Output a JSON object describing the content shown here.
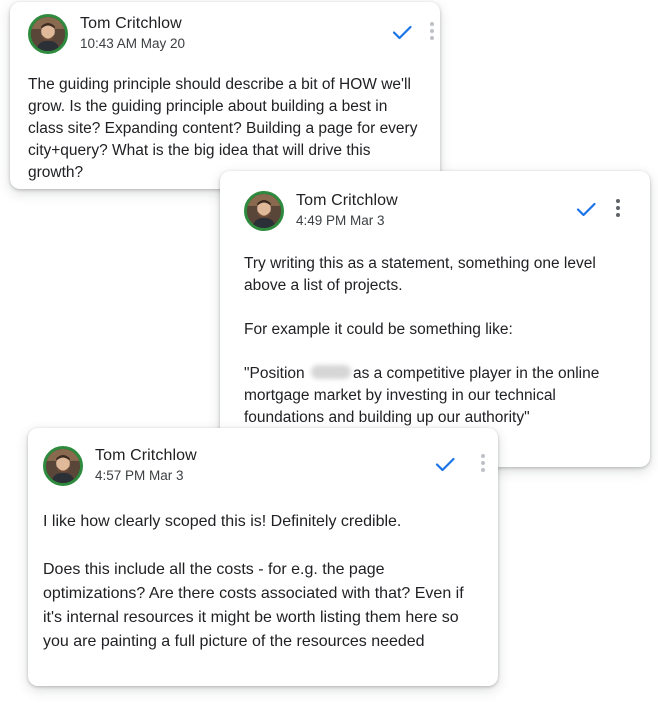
{
  "comments": [
    {
      "author": "Tom Critchlow",
      "timestamp": "10:43 AM May 20",
      "body": "The guiding principle should describe a bit of HOW we'll grow. Is the guiding principle about building a best in class site? Expanding content? Building a page for every city+query? What is the big idea that will drive this growth?"
    },
    {
      "author": "Tom Critchlow",
      "timestamp": "4:49 PM Mar 3",
      "body_p1": "Try writing this as a statement, something one level above a list of projects.",
      "body_p2": "For example it could be something like:",
      "body_p3_before": "\"Position ",
      "body_p3_after": "as a competitive player in the online mortgage market by investing in our technical foundations and building up our authority\""
    },
    {
      "author": "Tom Critchlow",
      "timestamp": "4:57 PM Mar 3",
      "body_p1": "I like how clearly scoped this is! Definitely credible.",
      "body_p2": "Does this include all the costs - for e.g. the page optimizations? Are there costs associated with that? Even if it's internal resources it might be worth listing them here so you are painting a full picture of the resources needed"
    }
  ],
  "icons": {
    "resolve": "checkmark-icon",
    "more": "more-vert-icon",
    "avatar": "avatar"
  },
  "colors": {
    "check": "#1a73e8",
    "avatar_ring": "#2e8b3e",
    "more_active": "#5f6368",
    "more_inactive": "#bdc1c6"
  }
}
